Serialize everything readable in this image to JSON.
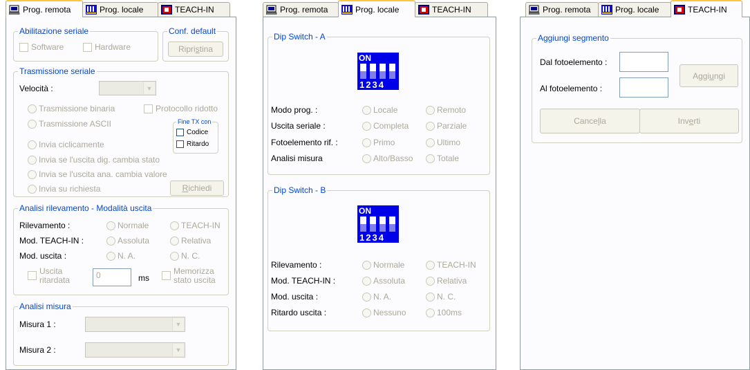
{
  "tabs": {
    "remote": "Prog. remota",
    "local": "Prog. locale",
    "teach": "TEACH-IN"
  },
  "panel1": {
    "abil_seriale": {
      "legend": "Abilitazione seriale",
      "software": "Software",
      "hardware": "Hardware"
    },
    "conf_default": {
      "legend": "Conf. default",
      "button_pre": "Ripri",
      "button_ul": "s",
      "button_post": "tina"
    },
    "trasm": {
      "legend": "Trasmissione seriale",
      "velocita_label": "Velocità :",
      "velocita_value": "",
      "binaria": "Trasmissione binaria",
      "ascii": "Trasmissione ASCII",
      "protocollo": "Protocollo ridotto",
      "fine_tx_legend": "Fine TX con",
      "codice": "Codice",
      "ritardo": "Ritardo",
      "ciclicamente": "Invia ciclicamente",
      "dig_cambia": "Invia se l'uscita dig. cambia stato",
      "ana_cambia": "Invia se l'uscita ana. cambia valore",
      "su_richiesta": "Invia su richiesta",
      "richiedi_ul": "R",
      "richiedi_post": "ichiedi"
    },
    "analisi_ril": {
      "legend": "Analisi rilevamento - Modalità uscita",
      "rilevamento": "Rilevamento :",
      "normale": "Normale",
      "teach_in": "TEACH-IN",
      "mod_teach": "Mod. TEACH-IN :",
      "assoluta": "Assoluta",
      "relativa": "Relativa",
      "mod_uscita": "Mod. uscita :",
      "na": "N. A.",
      "nc": "N. C.",
      "uscita_rit_1": "Uscita",
      "uscita_rit_2": "ritardata",
      "ms_value": "0",
      "ms_unit": "ms",
      "memorizza_1": "Memorizza",
      "memorizza_2": "stato uscita"
    },
    "analisi_misura": {
      "legend": "Analisi misura",
      "misura1": "Misura 1 :",
      "misura2": "Misura 2 :"
    }
  },
  "panel2": {
    "dip_a": {
      "legend": "Dip Switch - A",
      "on": "ON",
      "nums": "1234",
      "rows": [
        {
          "label": "Modo prog. :",
          "opt1": "Locale",
          "opt2": "Remoto"
        },
        {
          "label": "Uscita seriale :",
          "opt1": "Completa",
          "opt2": "Parziale"
        },
        {
          "label": "Fotoelemento rif. :",
          "opt1": "Primo",
          "opt2": "Ultimo"
        },
        {
          "label": "Analisi misura",
          "opt1": "Alto/Basso",
          "opt2": "Totale"
        }
      ]
    },
    "dip_b": {
      "legend": "Dip Switch - B",
      "on": "ON",
      "nums": "1234",
      "rows": [
        {
          "label": "Rilevamento :",
          "opt1": "Normale",
          "opt2": "TEACH-IN"
        },
        {
          "label": "Mod. TEACH-IN :",
          "opt1": "Assoluta",
          "opt2": "Relativa"
        },
        {
          "label": "Mod. uscita :",
          "opt1": "N. A.",
          "opt2": "N. C."
        },
        {
          "label": "Ritardo uscita :",
          "opt1": "Nessuno",
          "opt2": "100ms"
        }
      ]
    }
  },
  "panel3": {
    "legend": "Aggiungi segmento",
    "dal": "Dal fotoelemento :",
    "al": "Al fotoelemento :",
    "aggiungi_pre": "Aggi",
    "aggiungi_ul": "u",
    "aggiungi_post": "ngi",
    "cancella_pre": "Cance",
    "cancella_ul": "l",
    "cancella_post": "la",
    "inverti_pre": "Inv",
    "inverti_ul": "e",
    "inverti_post": "rti"
  },
  "colors": {
    "legend_blue": "#0046d5",
    "disabled_text": "#aca899",
    "tab_highlight": "#ffc73c",
    "dip_blue": "#0000e8"
  },
  "icons": {
    "remote_tab": "monitor-icon",
    "local_tab": "dip-switch-icon",
    "teach_tab": "teach-in-icon"
  }
}
